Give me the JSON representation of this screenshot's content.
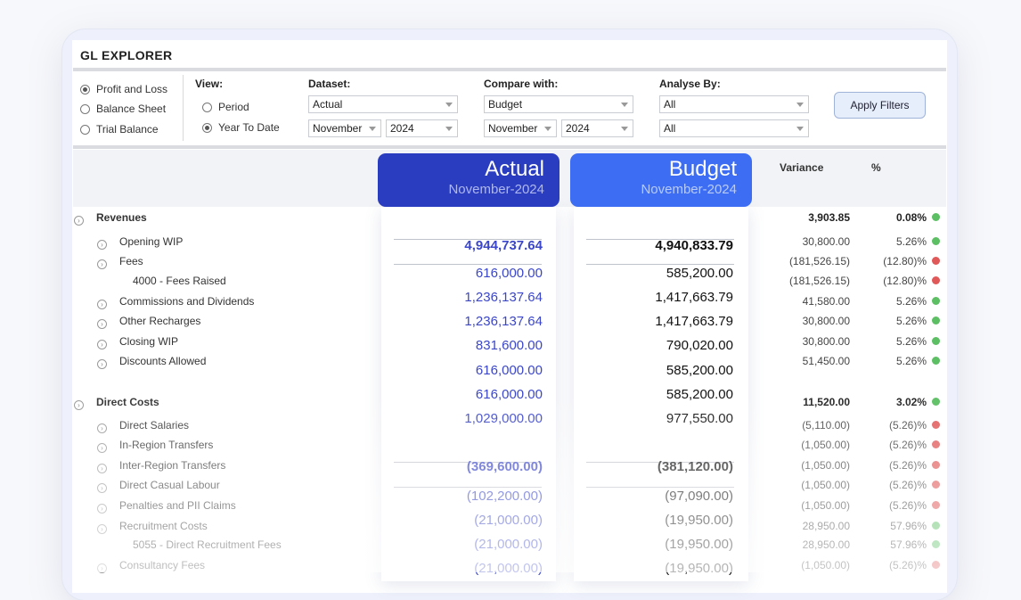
{
  "app": {
    "title": "GL EXPLORER"
  },
  "report_type": {
    "options": [
      "Profit and Loss",
      "Balance Sheet",
      "Trial Balance"
    ],
    "selected": "Profit and Loss"
  },
  "view": {
    "label": "View:",
    "options": [
      "Period",
      "Year To Date"
    ],
    "selected": "Year To Date"
  },
  "dataset": {
    "label": "Dataset:",
    "value": "Actual",
    "month": "November",
    "year": "2024"
  },
  "compare": {
    "label": "Compare with:",
    "value": "Budget",
    "month": "November",
    "year": "2024"
  },
  "analyse": {
    "label": "Analyse By:",
    "value1": "All",
    "value2": "All"
  },
  "apply_label": "Apply Filters",
  "columns": {
    "actual": {
      "title": "Actual",
      "period": "November-2024",
      "color": "#2a3cbf"
    },
    "budget": {
      "title": "Budget",
      "period": "November-2024",
      "color": "#3d6df2"
    },
    "variance": "Variance",
    "percent": "%"
  },
  "status_colors": {
    "green": "#5cbf63",
    "red": "#e05858"
  },
  "rows": [
    {
      "label": "Revenues",
      "bold": true,
      "variance": "3,903.85",
      "pct": "0.08%",
      "status": "green"
    },
    {
      "label": "Opening WIP",
      "variance": "30,800.00",
      "pct": "5.26%",
      "status": "green"
    },
    {
      "label": "Fees",
      "variance": "(181,526.15)",
      "pct": "(12.80)%",
      "status": "red"
    },
    {
      "label": "4000 - Fees Raised",
      "variance": "(181,526.15)",
      "pct": "(12.80)%",
      "status": "red"
    },
    {
      "label": "Commissions and Dividends",
      "variance": "41,580.00",
      "pct": "5.26%",
      "status": "green"
    },
    {
      "label": "Other Recharges",
      "variance": "30,800.00",
      "pct": "5.26%",
      "status": "green"
    },
    {
      "label": "Closing WIP",
      "variance": "30,800.00",
      "pct": "5.26%",
      "status": "green"
    },
    {
      "label": "Discounts Allowed",
      "variance": "51,450.00",
      "pct": "5.26%",
      "status": "green"
    },
    {
      "label": "Direct Costs",
      "bold": true,
      "variance": "11,520.00",
      "pct": "3.02%",
      "status": "green"
    },
    {
      "label": "Direct Salaries",
      "variance": "(5,110.00)",
      "pct": "(5.26)%",
      "status": "red"
    },
    {
      "label": "In-Region Transfers",
      "variance": "(1,050.00)",
      "pct": "(5.26)%",
      "status": "red"
    },
    {
      "label": "Inter-Region Transfers",
      "variance": "(1,050.00)",
      "pct": "(5.26)%",
      "status": "red"
    },
    {
      "label": "Direct Casual Labour",
      "variance": "(1,050.00)",
      "pct": "(5.26)%",
      "status": "red"
    },
    {
      "label": "Penalties and PII Claims",
      "variance": "(1,050.00)",
      "pct": "(5.26)%",
      "status": "red"
    },
    {
      "label": "Recruitment Costs",
      "variance": "28,950.00",
      "pct": "57.96%",
      "status": "green"
    },
    {
      "label": "5055 - Direct Recruitment Fees",
      "variance": "28,950.00",
      "pct": "57.96%",
      "status": "green"
    },
    {
      "label": "Consultancy Fees",
      "variance": "(1,050.00)",
      "pct": "(5.26)%",
      "status": "red"
    }
  ],
  "actual_values": [
    "4,944,737.64",
    "616,000.00",
    "1,236,137.64",
    "1,236,137.64",
    "831,600.00",
    "616,000.00",
    "616,000.00",
    "1,029,000.00",
    "(369,600.00)",
    "(102,200.00)",
    "(21,000.00)",
    "(21,000.00)",
    "(21,000.00)"
  ],
  "budget_values": [
    "4,940,833.79",
    "585,200.00",
    "1,417,663.79",
    "1,417,663.79",
    "790,020.00",
    "585,200.00",
    "585,200.00",
    "977,550.00",
    "(381,120.00)",
    "(97,090.00)",
    "(19,950.00)",
    "(19,950.00)",
    "(19,950.00)"
  ]
}
